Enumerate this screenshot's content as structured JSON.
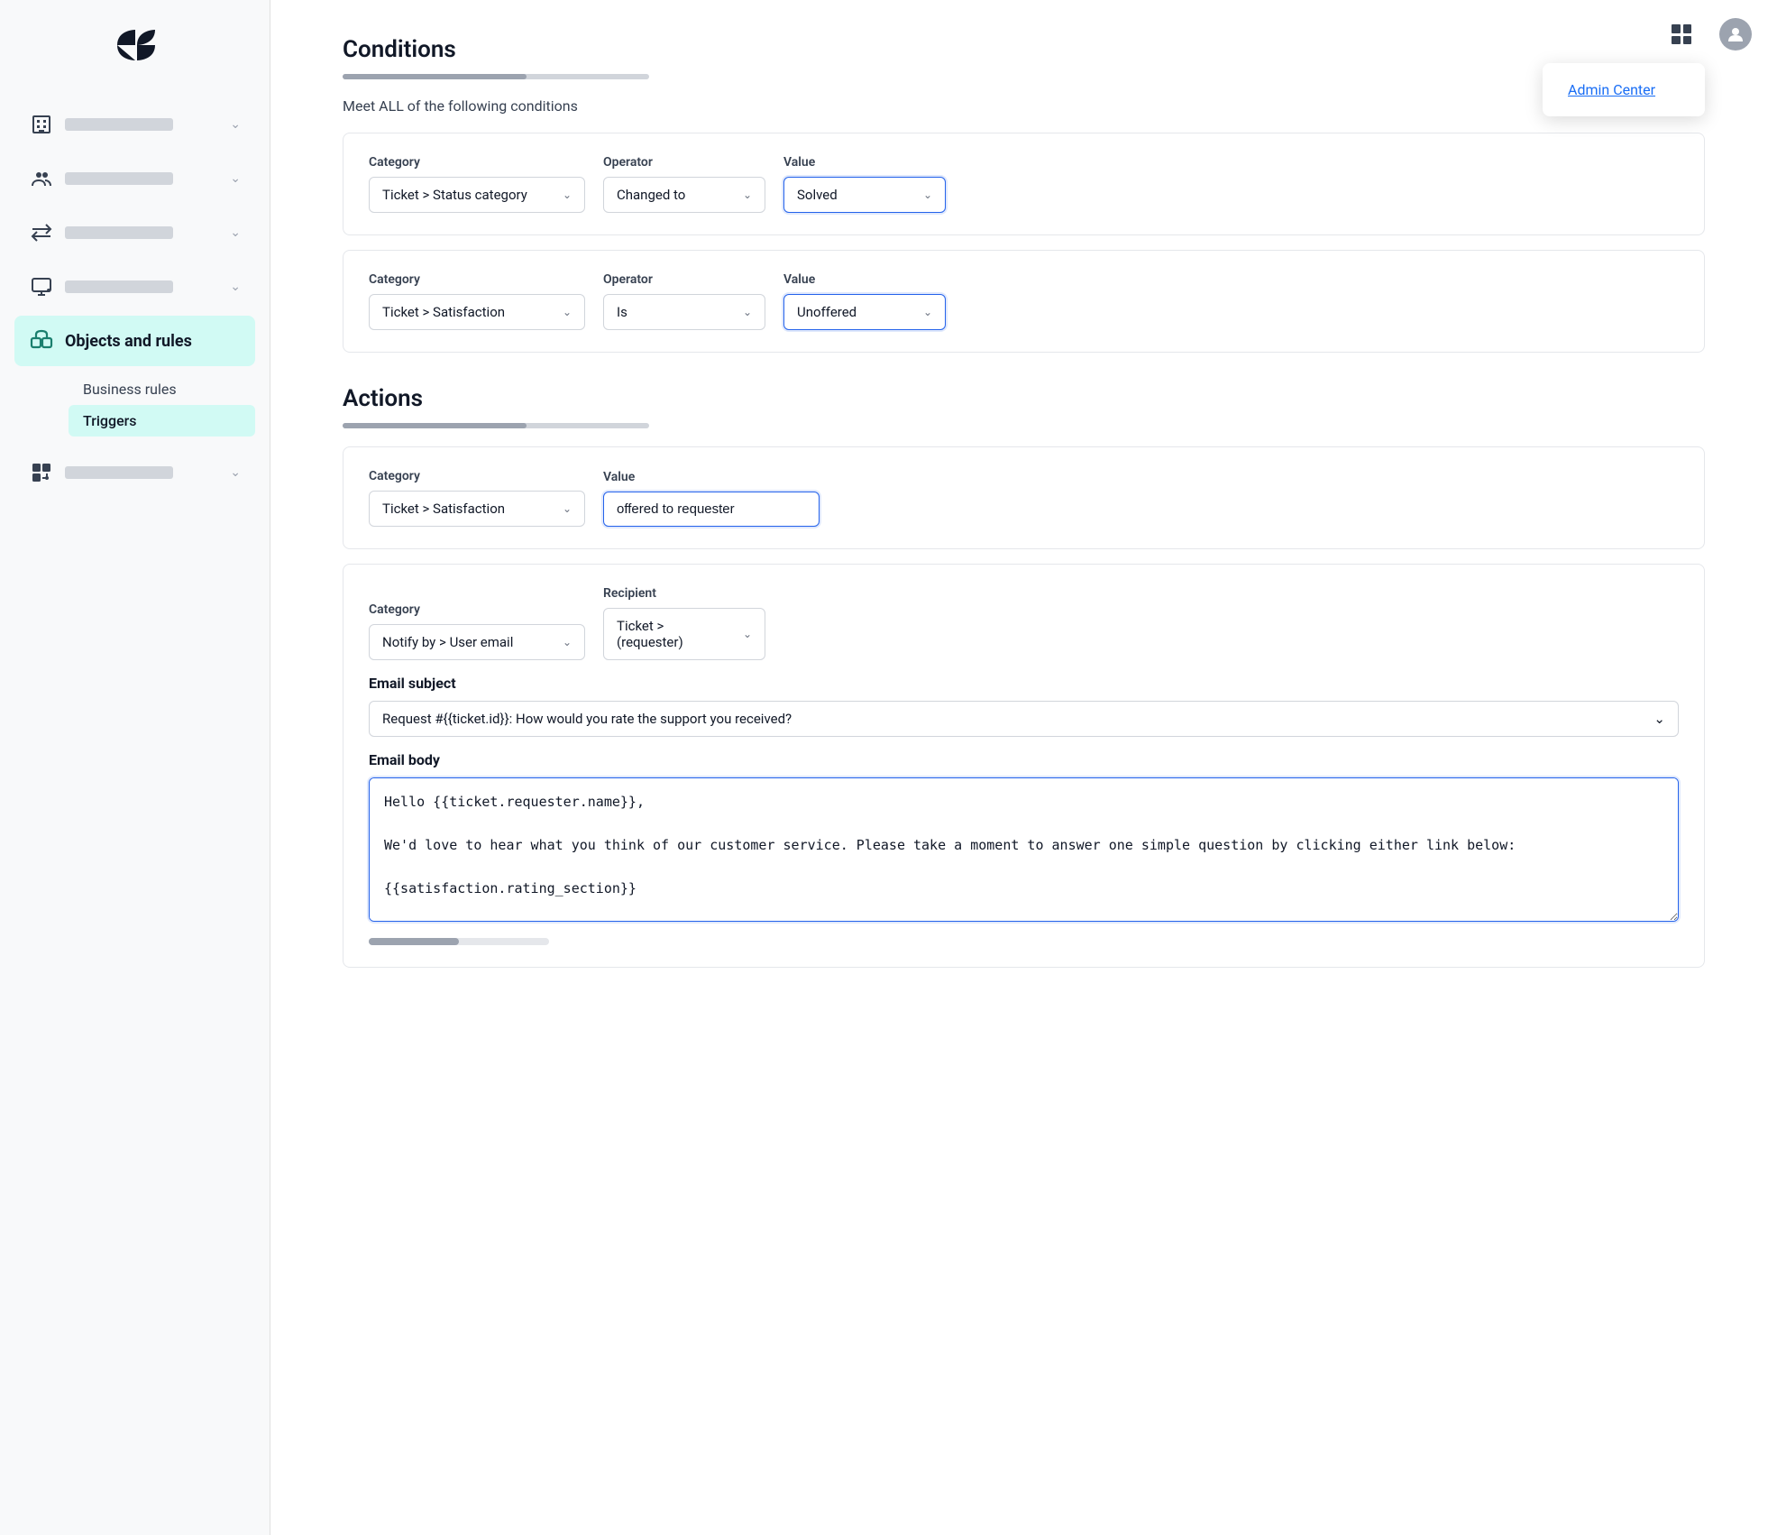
{
  "sidebar": {
    "logo_alt": "Zendesk logo",
    "items": [
      {
        "id": "admin",
        "icon": "building",
        "active": false
      },
      {
        "id": "people",
        "icon": "people",
        "active": false
      },
      {
        "id": "channels",
        "icon": "arrows",
        "active": false
      },
      {
        "id": "workspace",
        "icon": "monitor",
        "active": false
      },
      {
        "id": "objects",
        "icon": "objects",
        "label": "Objects and rules",
        "active": true
      },
      {
        "id": "apps",
        "icon": "apps",
        "active": false
      }
    ],
    "sub_items": [
      {
        "id": "business-rules",
        "label": "Business rules",
        "active": false
      },
      {
        "id": "triggers",
        "label": "Triggers",
        "active": true
      }
    ]
  },
  "top_bar": {
    "admin_center_label": "Admin Center"
  },
  "conditions": {
    "title": "Conditions",
    "subtitle": "Meet ALL of the following conditions",
    "rows": [
      {
        "category_label": "Category",
        "category_value": "Ticket > Status category",
        "operator_label": "Operator",
        "operator_value": "Changed to",
        "value_label": "Value",
        "value_value": "Solved",
        "value_focused": true
      },
      {
        "category_label": "Category",
        "category_value": "Ticket > Satisfaction",
        "operator_label": "Operator",
        "operator_value": "Is",
        "value_label": "Value",
        "value_value": "Unoffered",
        "value_focused": true
      }
    ]
  },
  "actions": {
    "title": "Actions",
    "rows": [
      {
        "type": "satisfaction",
        "category_label": "Category",
        "category_value": "Ticket > Satisfaction",
        "value_label": "Value",
        "value_value": "offered to requester",
        "value_focused": true
      },
      {
        "type": "notify",
        "category_label": "Category",
        "category_value": "Notify by > User email",
        "recipient_label": "Recipient",
        "recipient_value": "Ticket > (requester)"
      }
    ],
    "email_subject_label": "Email subject",
    "email_subject_value": "Request #{{ticket.id}}: How would you rate the support you received?",
    "email_body_label": "Email body",
    "email_body_value": "Hello {{ticket.requester.name}},\n\nWe'd love to hear what you think of our customer service. Please take a moment to answer one simple question by clicking either link below:\n\n{{satisfaction.rating_section}}\n\nHere's a reminder of what this request was about:"
  }
}
